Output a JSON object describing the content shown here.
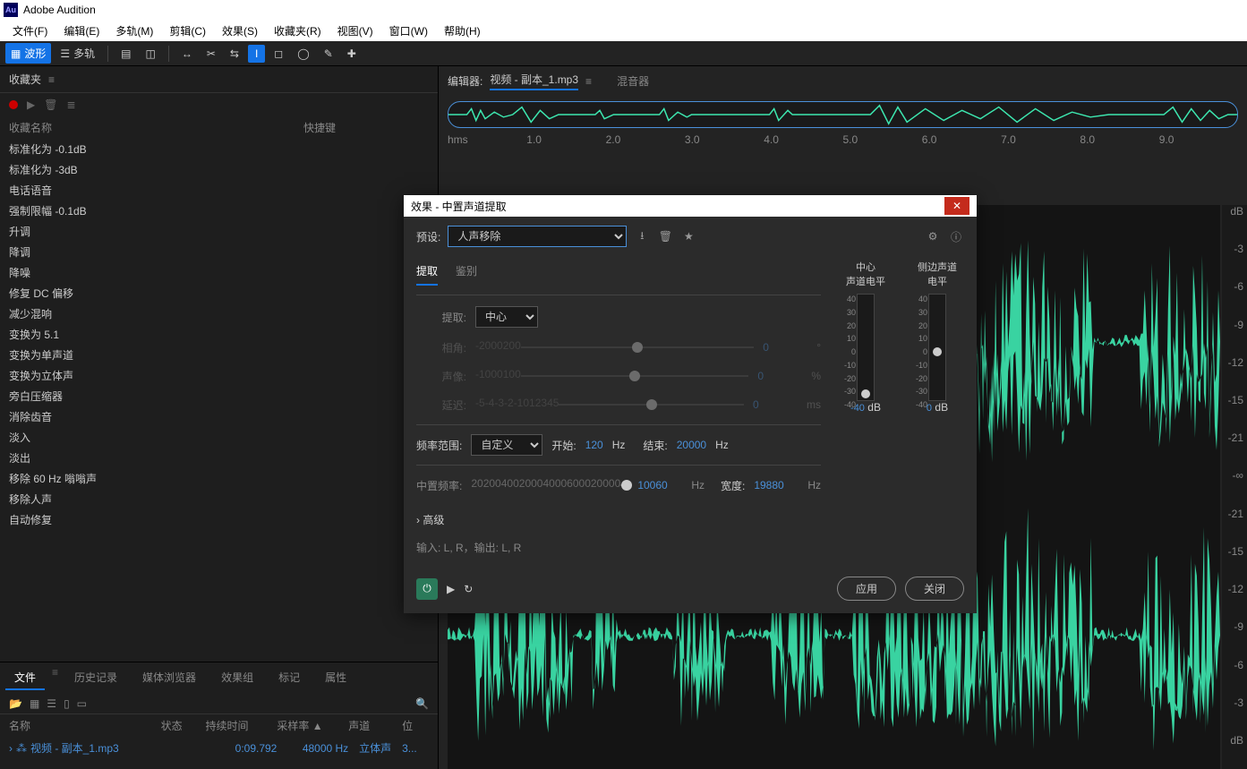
{
  "app_title": "Adobe Audition",
  "menu": [
    "文件(F)",
    "编辑(E)",
    "多轨(M)",
    "剪辑(C)",
    "效果(S)",
    "收藏夹(R)",
    "视图(V)",
    "窗口(W)",
    "帮助(H)"
  ],
  "toolbar": {
    "waveform": "波形",
    "multitrack": "多轨"
  },
  "favorites": {
    "title": "收藏夹",
    "cols": {
      "name": "收藏名称",
      "shortcut": "快捷键"
    },
    "items": [
      "标准化为 -0.1dB",
      "标准化为 -3dB",
      "电话语音",
      "强制限幅 -0.1dB",
      "升调",
      "降调",
      "降噪",
      "修复 DC 偏移",
      "减少混响",
      "变换为 5.1",
      "变换为单声道",
      "变换为立体声",
      "旁白压缩器",
      "消除齿音",
      "淡入",
      "淡出",
      "移除 60 Hz 嗡嗡声",
      "移除人声",
      "自动修复"
    ]
  },
  "files_panel": {
    "tabs": [
      "文件",
      "历史记录",
      "媒体浏览器",
      "效果组",
      "标记",
      "属性"
    ],
    "cols": [
      "名称",
      "状态",
      "持续时间",
      "采样率 ▲",
      "声道",
      "位"
    ],
    "row": {
      "name": "视频 - 副本_1.mp3",
      "duration": "0:09.792",
      "rate": "48000 Hz",
      "channels": "立体声",
      "bits": "3..."
    }
  },
  "editor": {
    "label": "编辑器:",
    "filename": "视频 - 副本_1.mp3",
    "mixer": "混音器",
    "ruler": [
      "hms",
      "1.0",
      "2.0",
      "3.0",
      "4.0",
      "5.0",
      "6.0",
      "7.0",
      "8.0",
      "9.0"
    ],
    "db_marks": [
      "dB",
      "-3",
      "-6",
      "-9",
      "-12",
      "-15",
      "-21",
      "-∞",
      "-21",
      "-15",
      "-12",
      "-9",
      "-6",
      "-3",
      "dB"
    ]
  },
  "dialog": {
    "title": "效果 - 中置声道提取",
    "preset_label": "预设:",
    "preset_value": "人声移除",
    "tab_extract": "提取",
    "tab_discrim": "鉴别",
    "extract_label": "提取:",
    "extract_value": "中心",
    "phase_label": "相角:",
    "phase_marks": [
      "-200",
      "0",
      "200"
    ],
    "phase_val": "0",
    "phase_unit": "°",
    "pan_label": "声像:",
    "pan_marks": [
      "-100",
      "0",
      "100"
    ],
    "pan_val": "0",
    "pan_unit": "%",
    "delay_label": "延迟:",
    "delay_marks": [
      "-5",
      "-4",
      "-3",
      "-2",
      "-1",
      "0",
      "1",
      "2",
      "3",
      "4",
      "5"
    ],
    "delay_val": "0",
    "delay_unit": "ms",
    "freq_label": "频率范围:",
    "freq_preset": "自定义",
    "start_label": "开始:",
    "start_val": "120",
    "end_label": "结束:",
    "end_val": "20000",
    "hz": "Hz",
    "center_label": "中置频率:",
    "center_marks": [
      "20",
      "200",
      "400",
      "2000",
      "4000",
      "6000",
      "20000"
    ],
    "center_val": "10060",
    "width_label": "宽度:",
    "width_val": "19880",
    "meter1_title": "中心\n声道电平",
    "meter2_title": "侧边声道\n电平",
    "meter_marks": [
      "40",
      "30",
      "20",
      "10",
      "0",
      "-10",
      "-20",
      "-30",
      "-40"
    ],
    "meter1_val": "-40",
    "meter2_val": "0",
    "db": "dB",
    "advanced": "高级",
    "io": "输入: L, R，输出: L, R",
    "apply": "应用",
    "close": "关闭"
  }
}
